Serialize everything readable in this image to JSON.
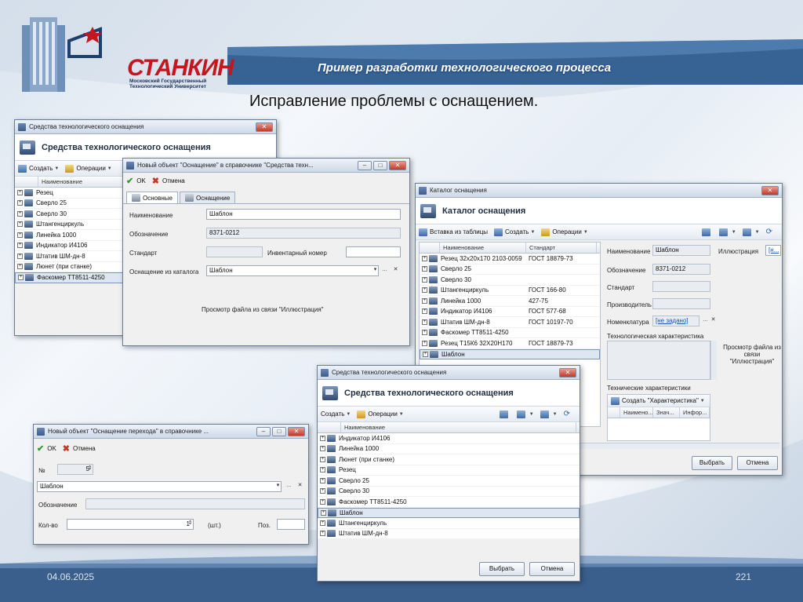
{
  "slide": {
    "title": "Пример разработки технологического процесса",
    "subtitle": "Исправление проблемы с оснащением.",
    "date": "04.06.2025",
    "page": "221",
    "logo_word": "СТАНКИН",
    "logo_sub": "Московский Государственный Технологический Университет"
  },
  "colors": {
    "accent": "#1c3f6e",
    "brand_red": "#c4161c",
    "selection": "#dde6f2"
  },
  "w1": {
    "title": "Средства технологического оснащения",
    "header": "Средства технологического оснащения",
    "create": "Создать",
    "operations": "Операции",
    "col_name": "Наименование",
    "items": [
      "Резец",
      "Сверло 25",
      "Сверло 30",
      "Штангенциркуль",
      "Линейка 1000",
      "Индикатор И4106",
      "Штатив ШМ-дн-8",
      "Люнет (при станке)",
      "Фаскомер ТТ8511-4250"
    ]
  },
  "w2": {
    "title": "Новый объект \"Оснащение\" в справочнике \"Средства техн...",
    "ok": "OK",
    "cancel": "Отмена",
    "tab_basic": "Основные",
    "tab_equip": "Оснащение",
    "name_label": "Наименование",
    "name_value": "Шаблон",
    "designation_label": "Обозначение",
    "designation_value": "8371-0212",
    "standard_label": "Стандарт",
    "inventory_label": "Инвентарный номер",
    "catalog_label": "Оснащение из каталога",
    "catalog_value": "Шаблон",
    "preview": "Просмотр файла из связи \"Иллюстрация\""
  },
  "w3": {
    "title": "Каталог оснащения",
    "header": "Каталог оснащения",
    "insert": "Вставка из таблицы",
    "create": "Создать",
    "operations": "Операции",
    "col_name": "Наименование",
    "col_std": "Стандарт",
    "rows": [
      {
        "name": "Резец 32х20х170 2103-0059",
        "std": "ГОСТ 18879-73"
      },
      {
        "name": "Сверло 25",
        "std": ""
      },
      {
        "name": "Сверло 30",
        "std": ""
      },
      {
        "name": "Штангенциркуль",
        "std": "ГОСТ 166-80"
      },
      {
        "name": "Линейка 1000",
        "std": "427-75"
      },
      {
        "name": "Индикатор И4106",
        "std": "ГОСТ 577-68"
      },
      {
        "name": "Штатив ШМ-дн-8",
        "std": "ГОСТ 10197-70"
      },
      {
        "name": "Фаскомер ТТ8511-4250",
        "std": ""
      },
      {
        "name": "Резец Т15К6 32Х20Н170",
        "std": "ГОСТ 18879-73"
      },
      {
        "name": "Шаблон",
        "std": ""
      }
    ],
    "name_label": "Наименование",
    "name_value": "Шаблон",
    "illus_label": "Иллюстрация",
    "illus_value": "[н...",
    "designation_label": "Обозначение",
    "designation_value": "8371-0212",
    "standard_label": "Стандарт",
    "maker_label": "Производитель",
    "nomencl_label": "Номенклатура",
    "nomencl_value": "[не задано]",
    "tech_char_label": "Технологическая характеристика",
    "preview": "Просмотр файла из связи \"Иллюстрация\"",
    "tech_specs_label": "Технические характеристики",
    "create_char": "Создать \"Характеристика\"",
    "col_a": "Наимено...",
    "col_b": "Знач...",
    "col_c": "Инфор...",
    "select_btn": "Выбрать",
    "cancel_btn": "Отмена"
  },
  "w4": {
    "title": "Средства технологического оснащения",
    "header": "Средства технологического оснащения",
    "create": "Создать",
    "operations": "Операции",
    "col_name": "Наименование",
    "items": [
      "Индикатор И4106",
      "Линейка 1000",
      "Люнет (при станке)",
      "Резец",
      "Сверло 25",
      "Сверло 30",
      "Фаскомер ТТ8511-4250",
      "Шаблон",
      "Штангенциркуль",
      "Штатив ШМ-дн-8"
    ],
    "select_btn": "Выбрать",
    "cancel_btn": "Отмена"
  },
  "w5": {
    "title": "Новый объект \"Оснащение перехода\" в справочнике ...",
    "ok": "OK",
    "cancel": "Отмена",
    "num_label": "№",
    "num_value": "5",
    "equip_value": "Шаблон",
    "designation_label": "Обозначение",
    "qty_label": "Кол-во",
    "qty_value": "1",
    "unit": "(шт.)",
    "pos_label": "Поз."
  }
}
